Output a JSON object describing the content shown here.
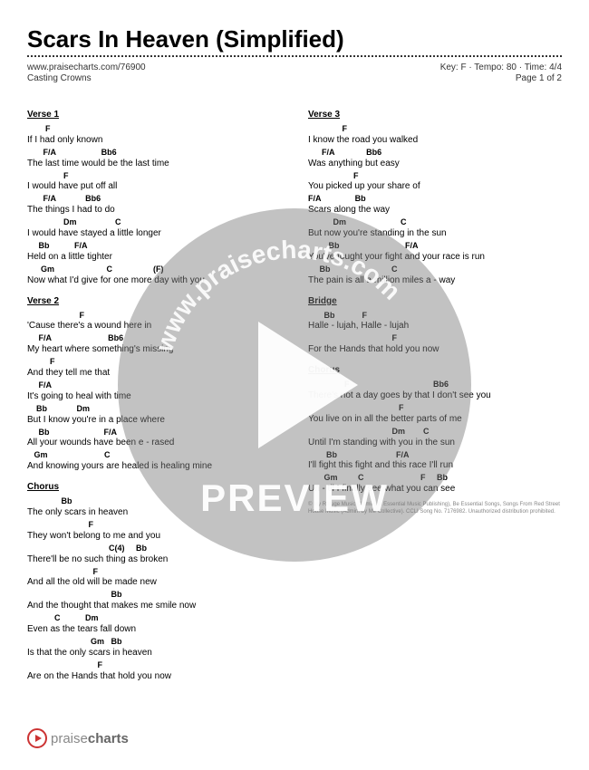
{
  "title": "Scars In Heaven (Simplified)",
  "meta": {
    "url": "www.praisecharts.com/76900",
    "info": "Key: F · Tempo: 80 · Time: 4/4",
    "artist": "Casting Crowns",
    "page": "Page 1 of 2"
  },
  "col1": {
    "sections": [
      {
        "head": "Verse 1",
        "lines": [
          {
            "c": "        F",
            "l": "If I had only known"
          },
          {
            "c": "       F/A                    Bb6",
            "l": "The last time would be the last time"
          },
          {
            "c": "                F",
            "l": "I would have put off all"
          },
          {
            "c": "       F/A             Bb6",
            "l": "The things I had to  do"
          },
          {
            "c": "                Dm                 C",
            "l": "I would have stayed a little longer"
          },
          {
            "c": "     Bb           F/A",
            "l": "Held on a little tighter"
          },
          {
            "c": "      Gm                       C                  (F)",
            "l": "Now what I'd give for one more day with you"
          }
        ]
      },
      {
        "head": "Verse 2",
        "lines": [
          {
            "c": "                       F",
            "l": "'Cause there's a wound here in"
          },
          {
            "c": "     F/A                         Bb6",
            "l": "My heart where something's missing"
          },
          {
            "c": "          F",
            "l": "And they tell me that"
          },
          {
            "c": "     F/A",
            "l": "It's going to heal with time"
          },
          {
            "c": "    Bb             Dm",
            "l": "But I know you're in a place where"
          },
          {
            "c": "     Bb                        F/A",
            "l": "All your wounds have been e - rased"
          },
          {
            "c": "   Gm                         C",
            "l": "And knowing yours are healed is healing mine"
          }
        ]
      },
      {
        "head": "Chorus",
        "lines": [
          {
            "c": "               Bb",
            "l": "The only scars in heaven"
          },
          {
            "c": "                           F",
            "l": "They won't belong to me and you"
          },
          {
            "c": "                                    C(4)     Bb",
            "l": "There'll be no such thing as broken"
          },
          {
            "c": "                             F",
            "l": "And all the old will be made new"
          },
          {
            "c": "                                     Bb",
            "l": "And the thought that makes me smile now"
          },
          {
            "c": "            C           Dm",
            "l": "Even as the tears fall down"
          },
          {
            "c": "                            Gm   Bb",
            "l": "Is that the only scars in heaven"
          },
          {
            "c": "                               F",
            "l": "Are on the Hands that hold you now"
          }
        ]
      }
    ]
  },
  "col2": {
    "sections": [
      {
        "head": "Verse 3",
        "lines": [
          {
            "c": "               F",
            "l": "I know the road you walked"
          },
          {
            "c": "      F/A              Bb6",
            "l": "Was anything but easy"
          },
          {
            "c": "                    F",
            "l": "You picked up your share of"
          },
          {
            "c": "F/A               Bb",
            "l": "Scars along the way"
          },
          {
            "c": "           Dm                        C",
            "l": "But now you're standing in the sun"
          },
          {
            "c": "         Bb                             F/A",
            "l": "You've fought your fight and your race is run"
          },
          {
            "c": "     Bb                           C",
            "l": "The pain is all a million miles a - way"
          }
        ]
      },
      {
        "head": "Bridge",
        "lines": [
          {
            "c": "       Bb            F",
            "l": "Halle - lujah, Halle - lujah"
          },
          {
            "c": "                                     F",
            "l": "For the Hands that hold you now"
          }
        ]
      },
      {
        "head": "Chorus",
        "lines": [
          {
            "c": "                F                                     Bb6",
            "l": "There's not a day goes by that I don't see you"
          },
          {
            "c": "                                        F",
            "l": "You live on in all the better parts of me"
          },
          {
            "c": "                                     Dm        C",
            "l": "Until I'm standing with you in the sun"
          },
          {
            "c": "        Bb                          F/A",
            "l": "I'll fight this fight and this race I'll run"
          },
          {
            "c": "       Gm         C                         F     Bb",
            "l": "Un - til  I finally see what you can see"
          }
        ]
      }
    ],
    "copyright": "© My Refuge Music (Admin. at Essential Music Publishing), Be Essential Songs, Songs From Red Street House Music (Admin. by Me Collective). CCLI Song No. 7176982. Unauthorized distribution prohibited."
  },
  "footer": {
    "brand1": "praise",
    "brand2": "charts"
  },
  "watermark": {
    "url": "www.praisecharts.com",
    "preview": "PREVIEW"
  }
}
